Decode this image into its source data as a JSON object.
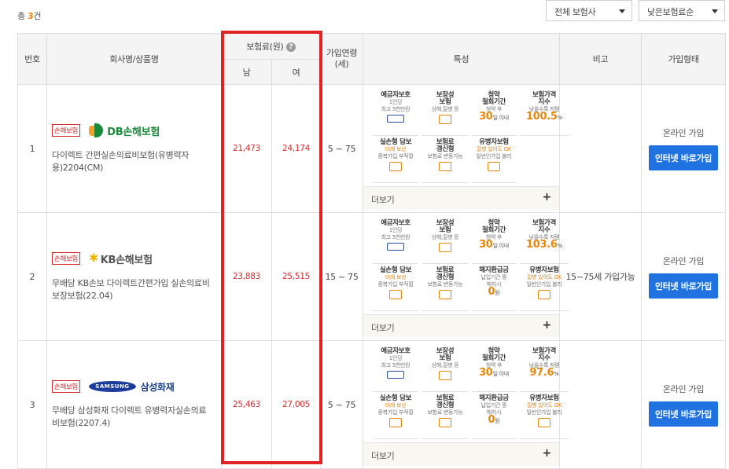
{
  "summary": {
    "prefix": "총",
    "count": "3",
    "suffix": "건"
  },
  "filters": {
    "company": "전체 보험사",
    "sort": "낮은보험료순"
  },
  "table": {
    "headers": {
      "num": "번호",
      "company": "회사명/상품명",
      "premium": "보험료(원)",
      "male": "남",
      "female": "여",
      "age": "가입연령\n(세)",
      "features": "특성",
      "note": "비고",
      "join": "가입형태"
    },
    "rows": [
      {
        "num": "1",
        "badge": "손해보험",
        "logo": "DB손해보험",
        "product": "다이렉트 간편실손의료비보험(유병력자용)2204(CM)",
        "male": "21,473",
        "female": "24,174",
        "age": "5 ~ 75",
        "features": {
          "f1_title": "예금자보호",
          "f1_sub": "1인당\n최고 5천만원",
          "f2_title": "보장성\n보험",
          "f2_sub": "상해,질병 등",
          "f3_title": "청약\n철회기간",
          "f3_sub": "청약 후",
          "f3_big": "30",
          "f3_unit": "일 이내",
          "f4_title": "보험가격\n지수",
          "f4_sub": "낮을수록 저렴",
          "f4_big": "100.5",
          "f4_unit": "%",
          "f5_title": "실손형 담보",
          "f5_org": "비례 보상",
          "f5_sub": "중복가입 부적절",
          "f6_title": "보험료\n갱신형",
          "f6_sub": "보험료 변동가능",
          "f7_title": "유병자보험",
          "f7_org": "질병 있어도 OK",
          "f7_sub": "일반인가입 불리"
        },
        "more": "더보기",
        "note": "",
        "join_type": "온라인 가입",
        "button": "인터넷 바로가입"
      },
      {
        "num": "2",
        "badge": "손해보험",
        "logo": "KB손해보험",
        "product": "무배당 KB손보 다이렉트간편가입 실손의료비보장보험(22.04)",
        "male": "23,883",
        "female": "25,515",
        "age": "15 ~ 75",
        "features": {
          "f1_title": "예금자보호",
          "f1_sub": "1인당\n최고 5천만원",
          "f2_title": "보장성\n보험",
          "f2_sub": "상해,질병 등",
          "f3_title": "청약\n철회기간",
          "f3_sub": "청약 후",
          "f3_big": "30",
          "f3_unit": "일 이내",
          "f4_title": "보험가격\n지수",
          "f4_sub": "낮을수록 저렴",
          "f4_big": "103.6",
          "f4_unit": "%",
          "f5_title": "실손형 담보",
          "f5_org": "비례 보상",
          "f5_sub": "중복가입 부적절",
          "f6_title": "보험료\n갱신형",
          "f6_sub": "보험료 변동가능",
          "f7_title": "해지환급금",
          "f7_org": "",
          "f7_sub": "납입기간 중\n해지시",
          "f7_big": "0",
          "f7_unit": "원",
          "f8_title": "유병자보험",
          "f8_org": "질병 있어도 OK",
          "f8_sub": "일반인가입 불리"
        },
        "more": "더보기",
        "note": "15~75세 가입가능",
        "join_type": "온라인 가입",
        "button": "인터넷 바로가입"
      },
      {
        "num": "3",
        "badge": "손해보험",
        "logo_mark": "SAMSUNG",
        "logo": "삼성화재",
        "product": "무배당 삼성화재 다이렉트 유병력자실손의료비보험(2207.4)",
        "male": "25,463",
        "female": "27,005",
        "age": "5 ~ 75",
        "features": {
          "f1_title": "예금자보호",
          "f1_sub": "1인당\n최고 5천만원",
          "f2_title": "보장성\n보험",
          "f2_sub": "상해,질병 등",
          "f3_title": "청약\n철회기간",
          "f3_sub": "청약 후",
          "f3_big": "30",
          "f3_unit": "일 이내",
          "f4_title": "보험가격\n지수",
          "f4_sub": "낮을수록 저렴",
          "f4_big": "97.6",
          "f4_unit": "%",
          "f5_title": "실손형 담보",
          "f5_org": "비례 보상",
          "f5_sub": "중복가입 부적절",
          "f6_title": "보험료\n갱신형",
          "f6_sub": "보험료 변동가능",
          "f7_title": "해지환급금",
          "f7_org": "",
          "f7_sub": "납입기간 중\n해지시",
          "f7_big": "0",
          "f7_unit": "원",
          "f8_title": "유병자보험",
          "f8_org": "질병 있어도 OK",
          "f8_sub": "일반인가입 불리"
        },
        "more": "더보기",
        "note": "",
        "join_type": "온라인 가입",
        "button": "인터넷 바로가입"
      }
    ]
  },
  "colors": {
    "highlight": "#e02424",
    "accent": "#e8860c",
    "button": "#1f72e0",
    "price": "#d62b2b"
  }
}
